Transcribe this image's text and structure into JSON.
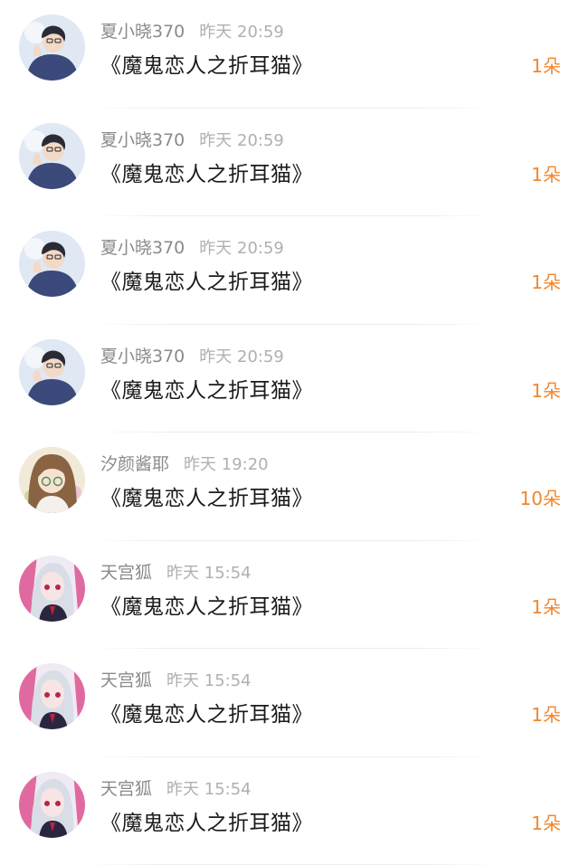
{
  "messages": [
    {
      "user": "夏小晓370",
      "time": "昨天 20:59",
      "title": "《魔鬼恋人之折耳猫》",
      "count": "1朵",
      "avatar": "boy-avatar-icon"
    },
    {
      "user": "夏小晓370",
      "time": "昨天 20:59",
      "title": "《魔鬼恋人之折耳猫》",
      "count": "1朵",
      "avatar": "boy-avatar-icon"
    },
    {
      "user": "夏小晓370",
      "time": "昨天 20:59",
      "title": "《魔鬼恋人之折耳猫》",
      "count": "1朵",
      "avatar": "boy-avatar-icon"
    },
    {
      "user": "夏小晓370",
      "time": "昨天 20:59",
      "title": "《魔鬼恋人之折耳猫》",
      "count": "1朵",
      "avatar": "boy-avatar-icon"
    },
    {
      "user": "汐颜酱耶",
      "time": "昨天 19:20",
      "title": "《魔鬼恋人之折耳猫》",
      "count": "10朵",
      "avatar": "girl-glasses-avatar-icon"
    },
    {
      "user": "天宫狐",
      "time": "昨天 15:54",
      "title": "《魔鬼恋人之折耳猫》",
      "count": "1朵",
      "avatar": "anime-girl-avatar-icon"
    },
    {
      "user": "天宫狐",
      "time": "昨天 15:54",
      "title": "《魔鬼恋人之折耳猫》",
      "count": "1朵",
      "avatar": "anime-girl-avatar-icon"
    },
    {
      "user": "天宫狐",
      "time": "昨天 15:54",
      "title": "《魔鬼恋人之折耳猫》",
      "count": "1朵",
      "avatar": "anime-girl-avatar-icon"
    }
  ],
  "colors": {
    "count": "#f0872d",
    "name": "#8a8a8a",
    "time": "#b0b0b0",
    "title": "#1b1b1b"
  }
}
